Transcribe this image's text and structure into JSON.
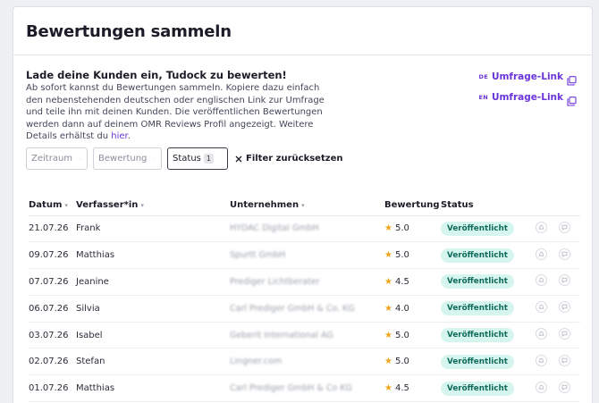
{
  "page": {
    "title": "Bewertungen sammeln"
  },
  "intro": {
    "title": "Lade deine Kunden ein, Tudock zu bewerten!",
    "text": "Ab sofort kannst du Bewertungen sammeln. Kopiere dazu einfach den nebenstehenden deutschen oder englischen Link zur Umfrage und teile ihn mit deinen Kunden. Die veröffentlichen Bewertungen werden dann auf deinem OMR Reviews Profil angezeigt. Weitere Details erhältst du ",
    "link_text": "hier",
    "text_end": "."
  },
  "survey_links": [
    {
      "lang": "DE",
      "label": "Umfrage-Link"
    },
    {
      "lang": "EN",
      "label": "Umfrage-Link"
    }
  ],
  "filters": {
    "zeitraum": "Zeitraum",
    "bewertung": "Bewertung",
    "status": "Status",
    "status_count": "1",
    "reset": "Filter zurücksetzen"
  },
  "table": {
    "headers": {
      "date": "Datum",
      "author": "Verfasser*in",
      "company": "Unternehmen",
      "rating": "Bewertung",
      "status": "Status"
    },
    "rows": [
      {
        "date": "21.07.26",
        "author": "Frank",
        "company": "HYDAC Digital GmbH",
        "rating": "5.0",
        "status": "Veröffentlicht"
      },
      {
        "date": "09.07.26",
        "author": "Matthias",
        "company": "Spurtt GmbH",
        "rating": "5.0",
        "status": "Veröffentlicht"
      },
      {
        "date": "07.07.26",
        "author": "Jeanine",
        "company": "Prediger Lichtberater",
        "rating": "4.5",
        "status": "Veröffentlicht"
      },
      {
        "date": "06.07.26",
        "author": "Silvia",
        "company": "Carl Prediger GmbH & Co. KG",
        "rating": "4.0",
        "status": "Veröffentlicht"
      },
      {
        "date": "03.07.26",
        "author": "Isabel",
        "company": "Geberit International AG",
        "rating": "5.0",
        "status": "Veröffentlicht"
      },
      {
        "date": "02.07.26",
        "author": "Stefan",
        "company": "Lingner.com",
        "rating": "5.0",
        "status": "Veröffentlicht"
      },
      {
        "date": "01.07.26",
        "author": "Matthias",
        "company": "Carl Prediger GmbH & Co KG",
        "rating": "4.5",
        "status": "Veröffentlicht"
      }
    ]
  },
  "colors": {
    "accent": "#6a35d9",
    "status_bg": "#d7f5ef",
    "status_text": "#0f6b5a",
    "star": "#f0a41e"
  }
}
